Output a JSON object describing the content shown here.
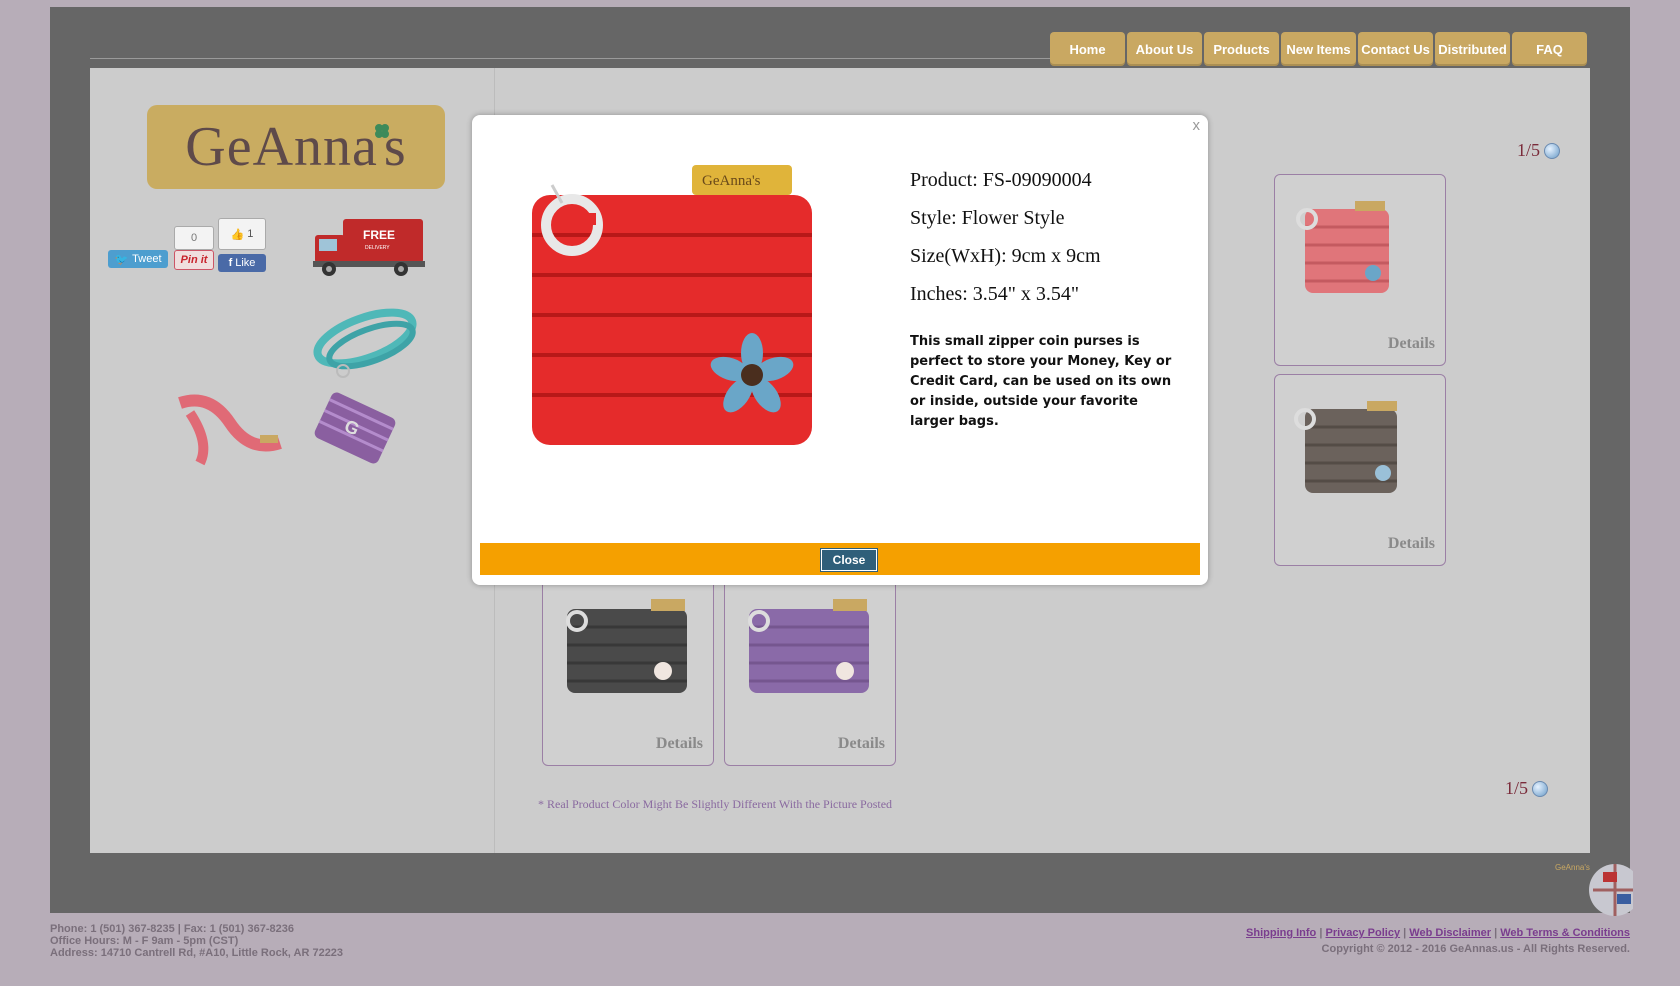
{
  "nav": {
    "items": [
      "Home",
      "About Us",
      "Products",
      "New Items",
      "Contact Us",
      "Distributed",
      "FAQ"
    ]
  },
  "sidebar": {
    "logo_text": "GeAnna's",
    "social": {
      "tweet_label": "Tweet",
      "pin_count": "0",
      "pin_label": "Pin it",
      "like_count": "1",
      "like_label": "Like"
    },
    "truck_text": "FREE",
    "truck_sub": "DELIVERY"
  },
  "main": {
    "pager_top": "1/5",
    "pager_bottom": "1/5",
    "cards": [
      {
        "details": "Details",
        "color": "#e0757a"
      },
      {
        "details": "Details",
        "color": "#4fa9ad"
      },
      {
        "details": "Details",
        "color": "#6b625c"
      },
      {
        "details": "Details",
        "color": "#4a4a4a"
      },
      {
        "details": "Details",
        "color": "#8a6aa8"
      }
    ],
    "note": "* Real Product Color Might Be Slightly Different With the Picture Posted"
  },
  "modal": {
    "close_x": "x",
    "product": "Product: FS-09090004",
    "style": "Style: Flower Style",
    "size": "Size(WxH): 9cm x 9cm",
    "inches": "Inches: 3.54\" x 3.54\"",
    "description": "This small zipper coin purses is perfect to store your Money, Key or Credit Card, can be used on its own or inside, outside your favorite larger bags.",
    "tag_text": "GeAnna's",
    "close_button": "Close",
    "accent": "#f5a000",
    "purse_color": "#e52b2b"
  },
  "footer": {
    "phone": "Phone: 1 (501) 367-8235 | Fax: 1 (501) 367-8236",
    "hours": "Office Hours: M - F 9am - 5pm (CST)",
    "address": "Address: 14710 Cantrell Rd, #A10, Little Rock, AR 72223",
    "links": [
      "Shipping Info",
      "Privacy Policy",
      "Web Disclaimer",
      "Web Terms & Conditions"
    ],
    "copyright": "Copyright © 2012 - 2016 GeAnnas.us - All Rights Reserved.",
    "globe_text": "GeAnna's"
  }
}
